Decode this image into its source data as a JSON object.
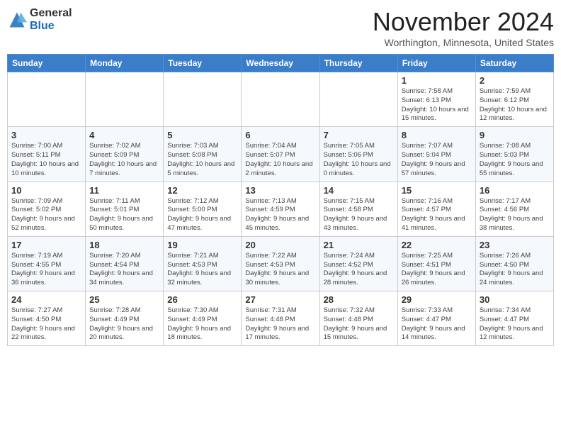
{
  "header": {
    "logo_line1": "General",
    "logo_line2": "Blue",
    "month": "November 2024",
    "location": "Worthington, Minnesota, United States"
  },
  "weekdays": [
    "Sunday",
    "Monday",
    "Tuesday",
    "Wednesday",
    "Thursday",
    "Friday",
    "Saturday"
  ],
  "weeks": [
    [
      {
        "day": "",
        "info": ""
      },
      {
        "day": "",
        "info": ""
      },
      {
        "day": "",
        "info": ""
      },
      {
        "day": "",
        "info": ""
      },
      {
        "day": "",
        "info": ""
      },
      {
        "day": "1",
        "info": "Sunrise: 7:58 AM\nSunset: 6:13 PM\nDaylight: 10 hours and 15 minutes."
      },
      {
        "day": "2",
        "info": "Sunrise: 7:59 AM\nSunset: 6:12 PM\nDaylight: 10 hours and 12 minutes."
      }
    ],
    [
      {
        "day": "3",
        "info": "Sunrise: 7:00 AM\nSunset: 5:11 PM\nDaylight: 10 hours and 10 minutes."
      },
      {
        "day": "4",
        "info": "Sunrise: 7:02 AM\nSunset: 5:09 PM\nDaylight: 10 hours and 7 minutes."
      },
      {
        "day": "5",
        "info": "Sunrise: 7:03 AM\nSunset: 5:08 PM\nDaylight: 10 hours and 5 minutes."
      },
      {
        "day": "6",
        "info": "Sunrise: 7:04 AM\nSunset: 5:07 PM\nDaylight: 10 hours and 2 minutes."
      },
      {
        "day": "7",
        "info": "Sunrise: 7:05 AM\nSunset: 5:06 PM\nDaylight: 10 hours and 0 minutes."
      },
      {
        "day": "8",
        "info": "Sunrise: 7:07 AM\nSunset: 5:04 PM\nDaylight: 9 hours and 57 minutes."
      },
      {
        "day": "9",
        "info": "Sunrise: 7:08 AM\nSunset: 5:03 PM\nDaylight: 9 hours and 55 minutes."
      }
    ],
    [
      {
        "day": "10",
        "info": "Sunrise: 7:09 AM\nSunset: 5:02 PM\nDaylight: 9 hours and 52 minutes."
      },
      {
        "day": "11",
        "info": "Sunrise: 7:11 AM\nSunset: 5:01 PM\nDaylight: 9 hours and 50 minutes."
      },
      {
        "day": "12",
        "info": "Sunrise: 7:12 AM\nSunset: 5:00 PM\nDaylight: 9 hours and 47 minutes."
      },
      {
        "day": "13",
        "info": "Sunrise: 7:13 AM\nSunset: 4:59 PM\nDaylight: 9 hours and 45 minutes."
      },
      {
        "day": "14",
        "info": "Sunrise: 7:15 AM\nSunset: 4:58 PM\nDaylight: 9 hours and 43 minutes."
      },
      {
        "day": "15",
        "info": "Sunrise: 7:16 AM\nSunset: 4:57 PM\nDaylight: 9 hours and 41 minutes."
      },
      {
        "day": "16",
        "info": "Sunrise: 7:17 AM\nSunset: 4:56 PM\nDaylight: 9 hours and 38 minutes."
      }
    ],
    [
      {
        "day": "17",
        "info": "Sunrise: 7:19 AM\nSunset: 4:55 PM\nDaylight: 9 hours and 36 minutes."
      },
      {
        "day": "18",
        "info": "Sunrise: 7:20 AM\nSunset: 4:54 PM\nDaylight: 9 hours and 34 minutes."
      },
      {
        "day": "19",
        "info": "Sunrise: 7:21 AM\nSunset: 4:53 PM\nDaylight: 9 hours and 32 minutes."
      },
      {
        "day": "20",
        "info": "Sunrise: 7:22 AM\nSunset: 4:53 PM\nDaylight: 9 hours and 30 minutes."
      },
      {
        "day": "21",
        "info": "Sunrise: 7:24 AM\nSunset: 4:52 PM\nDaylight: 9 hours and 28 minutes."
      },
      {
        "day": "22",
        "info": "Sunrise: 7:25 AM\nSunset: 4:51 PM\nDaylight: 9 hours and 26 minutes."
      },
      {
        "day": "23",
        "info": "Sunrise: 7:26 AM\nSunset: 4:50 PM\nDaylight: 9 hours and 24 minutes."
      }
    ],
    [
      {
        "day": "24",
        "info": "Sunrise: 7:27 AM\nSunset: 4:50 PM\nDaylight: 9 hours and 22 minutes."
      },
      {
        "day": "25",
        "info": "Sunrise: 7:28 AM\nSunset: 4:49 PM\nDaylight: 9 hours and 20 minutes."
      },
      {
        "day": "26",
        "info": "Sunrise: 7:30 AM\nSunset: 4:49 PM\nDaylight: 9 hours and 18 minutes."
      },
      {
        "day": "27",
        "info": "Sunrise: 7:31 AM\nSunset: 4:48 PM\nDaylight: 9 hours and 17 minutes."
      },
      {
        "day": "28",
        "info": "Sunrise: 7:32 AM\nSunset: 4:48 PM\nDaylight: 9 hours and 15 minutes."
      },
      {
        "day": "29",
        "info": "Sunrise: 7:33 AM\nSunset: 4:47 PM\nDaylight: 9 hours and 14 minutes."
      },
      {
        "day": "30",
        "info": "Sunrise: 7:34 AM\nSunset: 4:47 PM\nDaylight: 9 hours and 12 minutes."
      }
    ]
  ]
}
